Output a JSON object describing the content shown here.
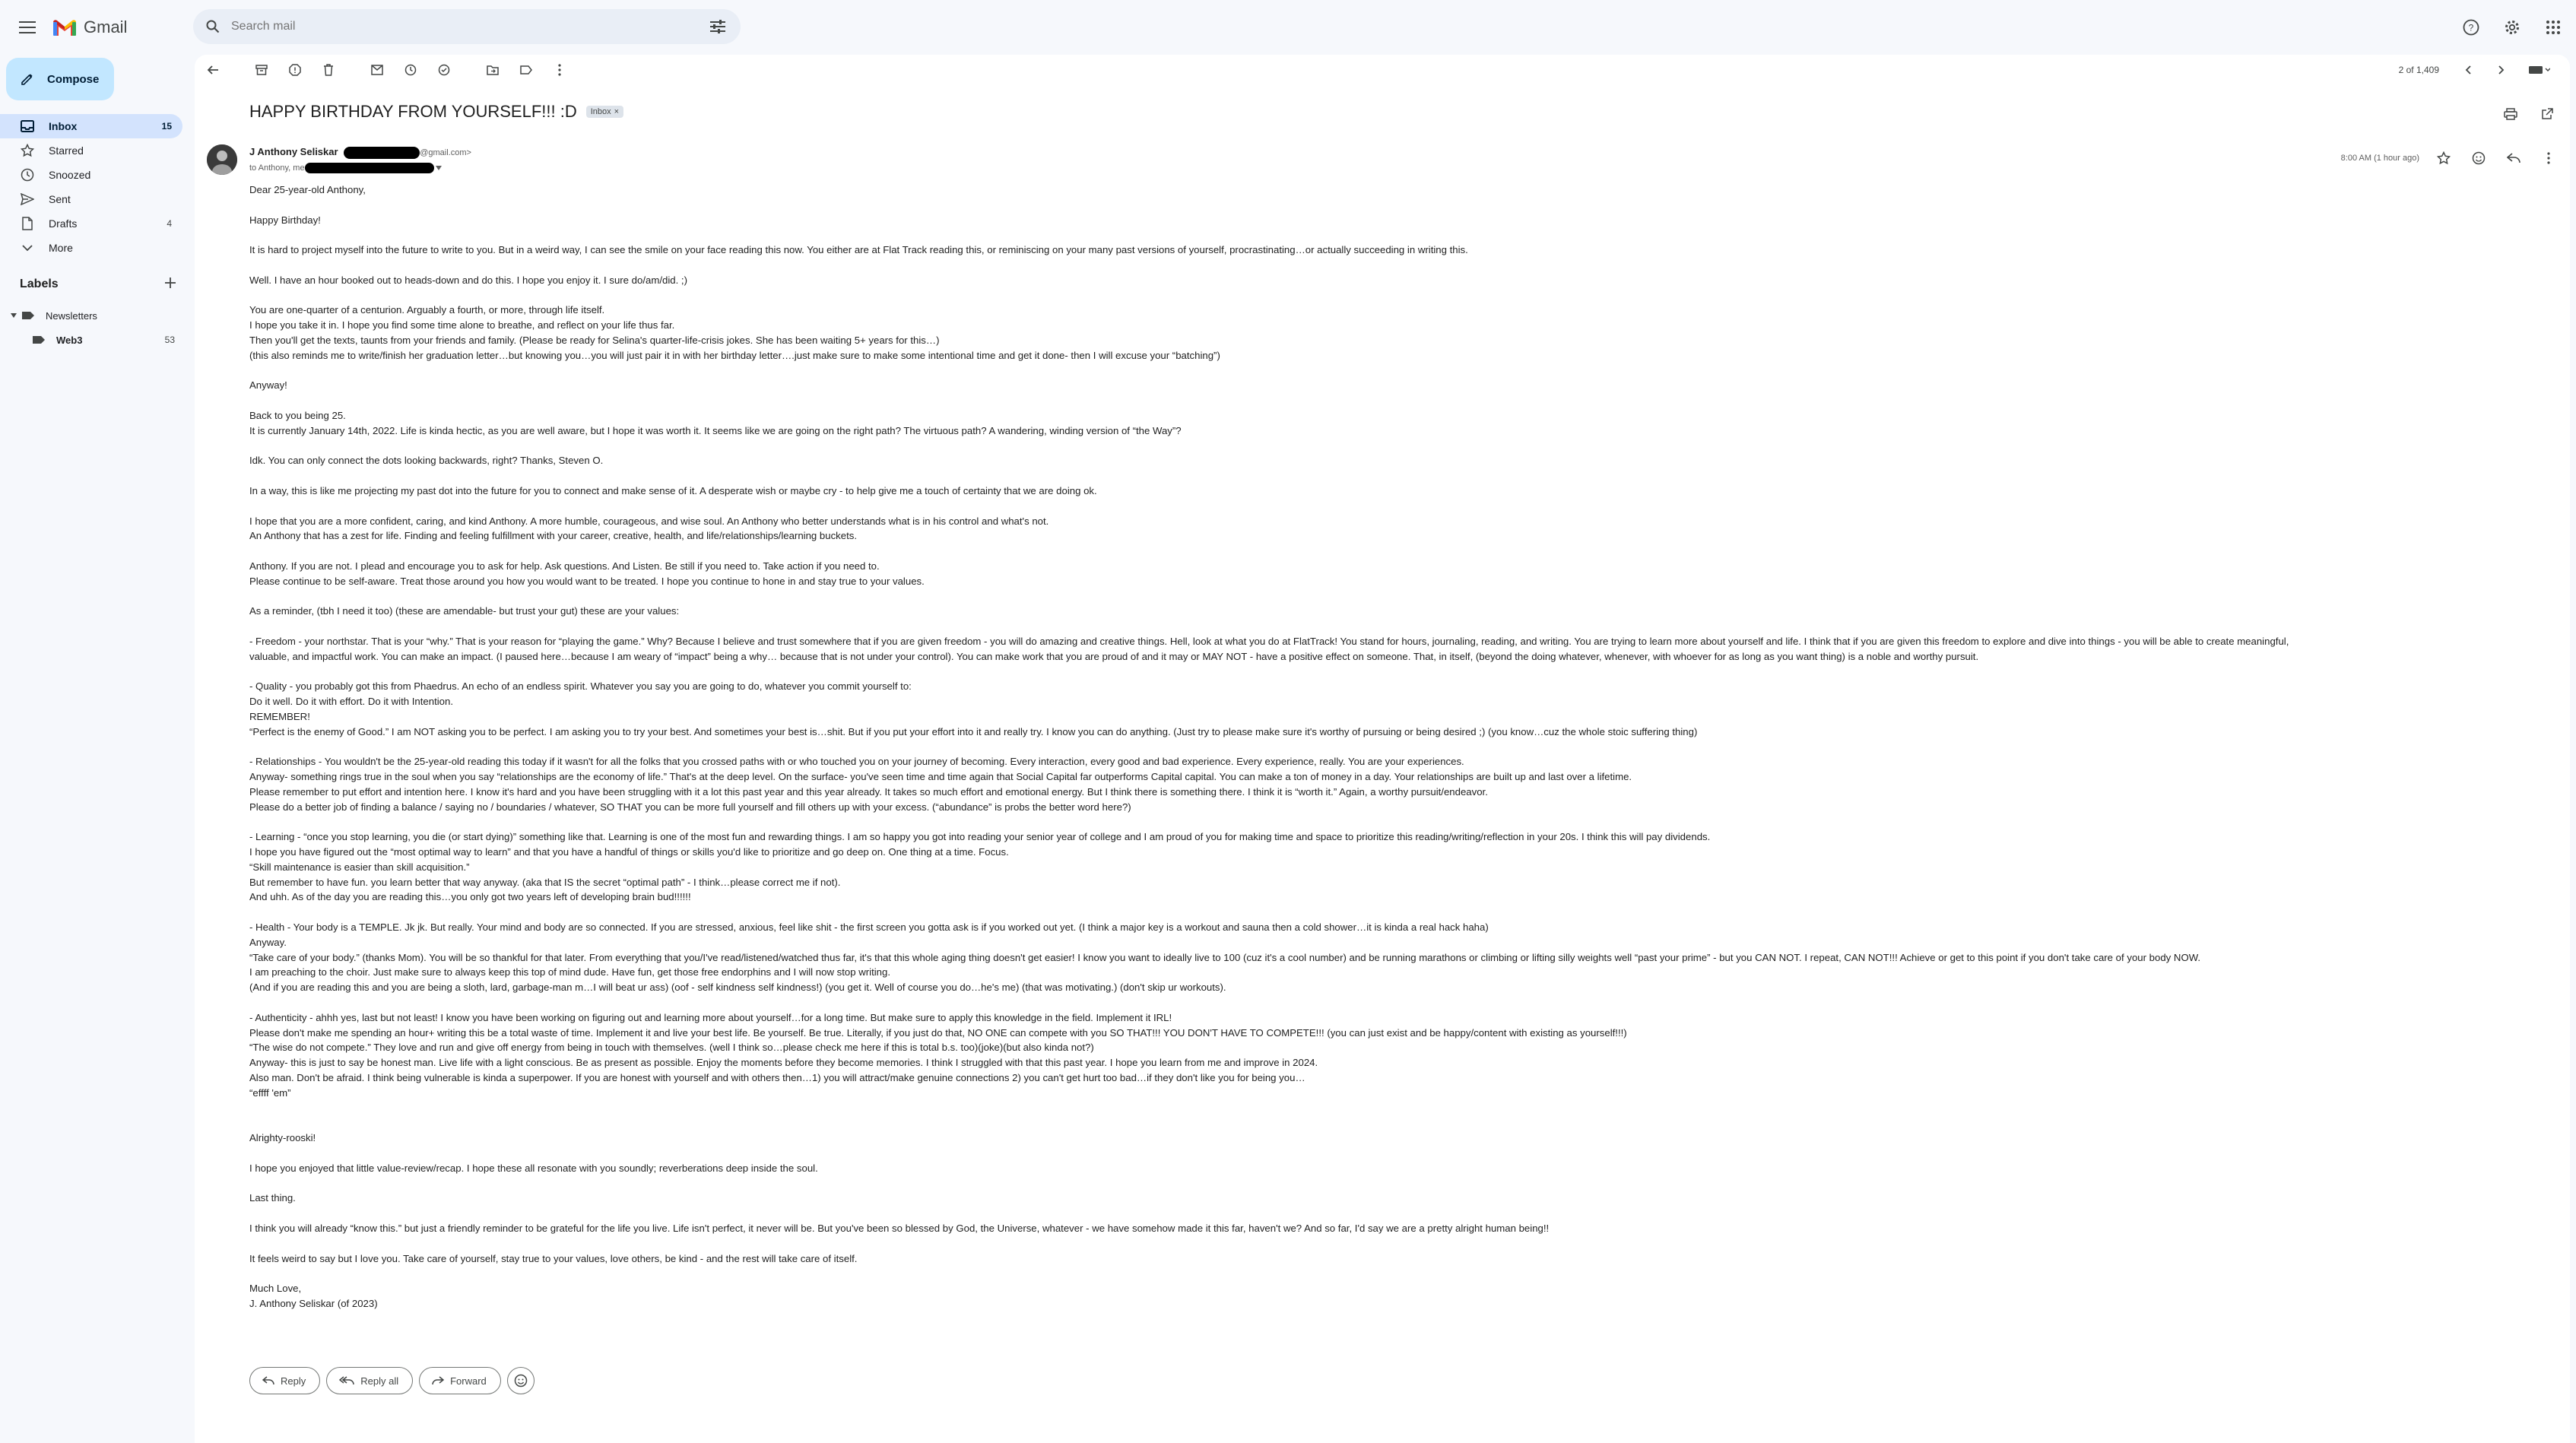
{
  "app": {
    "name": "Gmail"
  },
  "search": {
    "placeholder": "Search mail"
  },
  "sidebar": {
    "compose_label": "Compose",
    "items": [
      {
        "label": "Inbox",
        "count": "15",
        "icon": "inbox-icon",
        "active": true
      },
      {
        "label": "Starred",
        "count": "",
        "icon": "star-icon"
      },
      {
        "label": "Snoozed",
        "count": "",
        "icon": "clock-icon"
      },
      {
        "label": "Sent",
        "count": "",
        "icon": "send-icon"
      },
      {
        "label": "Drafts",
        "count": "4",
        "icon": "draft-icon"
      },
      {
        "label": "More",
        "count": "",
        "icon": "chevron-down-icon"
      }
    ],
    "labels_heading": "Labels",
    "labels": [
      {
        "label": "Newsletters",
        "count": ""
      },
      {
        "label": "Web3",
        "count": "53"
      }
    ]
  },
  "toolbar": {
    "pager": "2 of 1,409"
  },
  "email": {
    "subject": "HAPPY BIRTHDAY FROM YOURSELF!!! :D",
    "chip": "Inbox",
    "sender_name": "J Anthony Seliskar",
    "sender_email_suffix": "@gmail.com>",
    "to_prefix": "to Anthony, me",
    "time": "8:00 AM (1 hour ago)",
    "paragraphs": [
      [
        "Dear 25-year-old Anthony,"
      ],
      [
        "Happy Birthday!"
      ],
      [
        "It is hard to project myself into the future to write to you. But in a weird way, I can see the smile on your face reading this now. You either are at Flat Track reading this, or reminiscing on your many past versions of yourself, procrastinating…or actually succeeding in writing this."
      ],
      [
        "Well. I have an hour booked out to heads-down and do this. I hope you enjoy it. I sure do/am/did. ;)"
      ],
      [
        "You are one-quarter of a centurion. Arguably a fourth, or more, through life itself.",
        "I hope you take it in. I hope you find some time alone to breathe, and reflect on your life thus far.",
        "Then you'll get the texts, taunts from your friends and family. (Please be ready for Selina's quarter-life-crisis jokes. She has been waiting 5+ years for this…)",
        "(this also reminds me to write/finish her graduation letter…but knowing you…you will just pair it in with her birthday letter….just make sure to make some intentional time and get it done- then I will excuse your “batching”)"
      ],
      [
        "Anyway!"
      ],
      [
        "Back to you being 25.",
        "It is currently January 14th, 2022. Life is kinda hectic, as you are well aware, but I hope it was worth it. It seems like we are going on the right path? The virtuous path? A wandering, winding version of “the Way”?"
      ],
      [
        "Idk. You can only connect the dots looking backwards, right? Thanks, Steven O."
      ],
      [
        "In a way, this is like me projecting my past dot into the future for you to connect and make sense of it. A desperate wish or maybe cry - to help give me a touch of certainty that we are doing ok."
      ],
      [
        "I hope that you are a more confident, caring, and kind Anthony. A more humble, courageous, and wise soul. An Anthony who better understands what is in his control and what's not.",
        "An Anthony that has a zest for life. Finding and feeling fulfillment with your career, creative, health, and life/relationships/learning buckets."
      ],
      [
        "Anthony. If you are not. I plead and encourage you to ask for help. Ask questions. And Listen. Be still if you need to. Take action if you need to.",
        "Please continue to be self-aware. Treat those around you how you would want to be treated. I hope you continue to hone in and stay true to your values."
      ],
      [
        "As a reminder, (tbh I need it too) (these are amendable- but trust your gut) these are your values:"
      ],
      [
        "- Freedom - your northstar. That is your “why.” That is your reason for “playing the game.” Why? Because I believe and trust somewhere that if you are given freedom - you will do amazing and creative things. Hell, look at what you do at FlatTrack! You stand for hours, journaling, reading, and writing. You are trying to learn more about yourself and life. I think that if you are given this freedom to explore and dive into things - you will be able to create meaningful,",
        "valuable, and impactful work. You can make an impact. (I paused here…because I am weary of “impact” being a why… because that is not under your control). You can make work that you are proud of and it may or MAY NOT - have a positive effect on someone. That, in itself, (beyond the doing whatever, whenever, with whoever for as long as you want thing) is a noble and worthy pursuit."
      ],
      [
        "- Quality - you probably got this from Phaedrus. An echo of an endless spirit. Whatever you say you are going to do, whatever you commit yourself to:",
        "Do it well. Do it with effort. Do it with Intention.",
        "REMEMBER!",
        "“Perfect is the enemy of Good.” I am NOT asking you to be perfect. I am asking you to try your best. And sometimes your best is…shit. But if you put your effort into it and really try. I know you can do anything. (Just try to please make sure it's worthy of pursuing or being desired ;) (you know…cuz the whole stoic suffering thing)"
      ],
      [
        "- Relationships - You wouldn't be the 25-year-old reading this today if it wasn't for all the folks that you crossed paths with or who touched you on your journey of becoming. Every interaction, every good and bad experience. Every experience, really. You are your experiences.",
        "Anyway- something rings true in the soul when you say “relationships are the economy of life.” That's at the deep level. On the surface- you've seen time and time again that Social Capital far outperforms Capital capital. You can make a ton of money in a day. Your relationships are built up and last over a lifetime.",
        "Please remember to put effort and intention here. I know it's hard and you have been struggling with it a lot this past year and this year already. It takes so much effort and emotional energy. But I think there is something there. I think it is “worth it.” Again, a worthy pursuit/endeavor.",
        "Please do a better job of finding a balance / saying no / boundaries / whatever, SO THAT you can be more full yourself and fill others up with your excess. (“abundance” is probs the better word here?)"
      ],
      [
        "- Learning - “once you stop learning, you die (or start dying)” something like that. Learning is one of the most fun and rewarding things. I am so happy you got into reading your senior year of college and I am proud of you for making time and space to prioritize this reading/writing/reflection in your 20s. I think this will pay dividends.",
        "I hope you have figured out the “most optimal way to learn” and that you have a handful of things or skills you'd like to prioritize and go deep on. One thing at a time. Focus.",
        "“Skill maintenance is easier than skill acquisition.”",
        "But remember to have fun. you learn better that way anyway. (aka that IS the secret “optimal path” - I think…please correct me if not).",
        "And uhh. As of the day you are reading this…you only got two years left of developing brain bud!!!!!!"
      ],
      [
        "- Health - Your body is a TEMPLE. Jk jk. But really. Your mind and body are so connected. If you are stressed, anxious, feel like shit - the first screen you gotta ask is if you worked out yet. (I think a major key is a workout and sauna then a cold shower…it is kinda a real hack haha)",
        "Anyway.",
        "“Take care of your body.” (thanks Mom). You will be so thankful for that later. From everything that you/I've read/listened/watched thus far, it's that this whole aging thing doesn't get easier! I know you want to ideally live to 100 (cuz it's a cool number) and be running marathons or climbing or lifting silly weights well “past your prime” - but you CAN NOT. I repeat, CAN NOT!!! Achieve or get to this point if you don't take care of your body NOW.",
        "I am preaching to the choir. Just make sure to always keep this top of mind dude. Have fun, get those free endorphins and I will now stop writing.",
        "(And if you are reading this and you are being a sloth, lard, garbage-man m…I will beat ur ass) (oof - self kindness self kindness!) (you get it. Well of course you do…he's me) (that was motivating.) (don't skip ur workouts)."
      ],
      [
        "- Authenticity - ahhh yes, last but not least! I know you have been working on figuring out and learning more about yourself…for a long time. But make sure to apply this knowledge in the field. Implement it IRL!",
        "Please don't make me spending an hour+ writing this be a total waste of time. Implement it and live your best life. Be yourself. Be true. Literally, if you just do that, NO ONE can compete with you SO THAT!!! YOU DON'T HAVE TO COMPETE!!! (you can just exist and be happy/content with existing as yourself!!!)",
        "“The wise do not compete.” They love and run and give off energy from being in touch with themselves. (well I think so…please check me here if this is total b.s. too)(joke)(but also kinda not?)",
        "Anyway- this is just to say be honest man. Live life with a light conscious. Be as present as possible. Enjoy the moments before they become memories. I think I struggled with that this past year. I hope you learn from me and improve in 2024.",
        "Also man. Don't be afraid. I think being vulnerable is kinda a superpower. If you are honest with yourself and with others then…1) you will attract/make genuine connections 2) you can't get hurt too bad…if they don't like you for being you…",
        "“effff 'em”"
      ],
      [
        "Alrighty-rooski!"
      ],
      [
        "I hope you enjoyed that little value-review/recap. I hope these all resonate with you soundly; reverberations deep inside the soul."
      ],
      [
        "Last thing."
      ],
      [
        "I think you will already “know this.” but just a friendly reminder to be grateful for the life you live. Life isn't perfect, it never will be. But you've been so blessed by God, the Universe, whatever - we have somehow made it this far, haven't we? And so far, I'd say we are a pretty alright human being!!"
      ],
      [
        "It feels weird to say but I love you. Take care of yourself, stay true to your values, love others, be kind - and the rest will take care of itself."
      ],
      [
        "Much Love,",
        "J. Anthony Seliskar (of 2023)"
      ]
    ]
  },
  "actions": {
    "reply": "Reply",
    "reply_all": "Reply all",
    "forward": "Forward"
  },
  "colors": {
    "accent": "#c2e7ff",
    "active_nav": "#d3e3fd",
    "background": "#f6f8fc"
  }
}
